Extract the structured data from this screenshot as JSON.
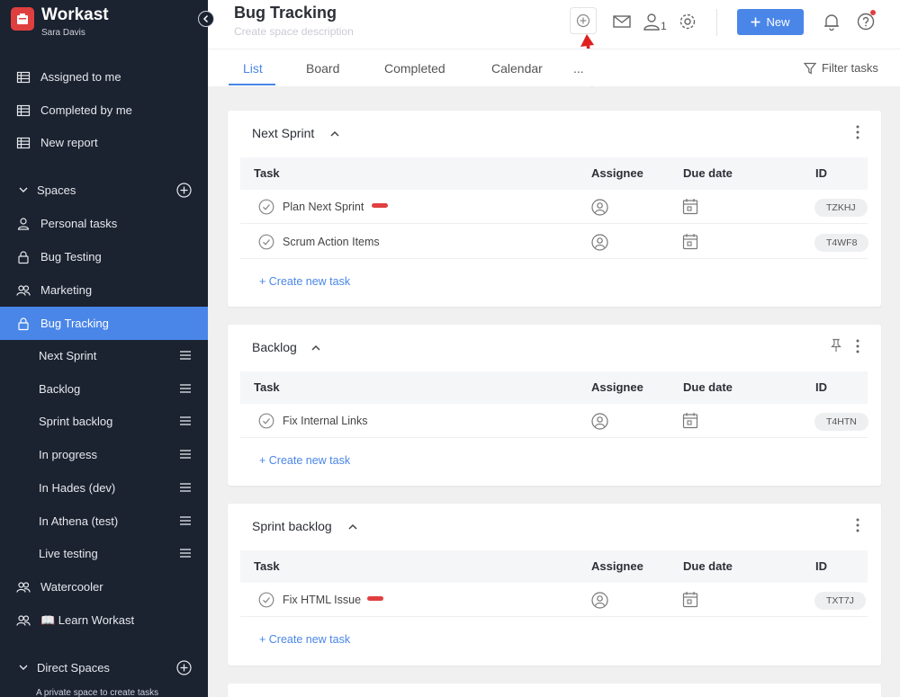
{
  "brand": {
    "name": "Workast",
    "user": "Sara Davis"
  },
  "sidebar": {
    "top_items": [
      {
        "label": "Assigned to me",
        "icon": "table-icon"
      },
      {
        "label": "Completed by me",
        "icon": "table-icon"
      },
      {
        "label": "New report",
        "icon": "table-icon"
      }
    ],
    "spaces_label": "Spaces",
    "spaces": [
      {
        "label": "Personal tasks",
        "icon": "person-icon"
      },
      {
        "label": "Bug Testing",
        "icon": "lock-icon"
      },
      {
        "label": "Marketing",
        "icon": "group-icon"
      },
      {
        "label": "Bug Tracking",
        "icon": "lock-icon",
        "active": true
      }
    ],
    "lists": [
      "Next Sprint",
      "Backlog",
      "Sprint backlog",
      "In progress",
      "In Hades (dev)",
      "In Athena (test)",
      "Live testing"
    ],
    "after_lists": [
      {
        "label": "Watercooler",
        "icon": "group-icon"
      },
      {
        "label": "📖 Learn Workast",
        "icon": "group-icon"
      }
    ],
    "direct_label": "Direct Spaces",
    "footer": "A private space to create tasks"
  },
  "header": {
    "title": "Bug Tracking",
    "description_placeholder": "Create space description",
    "member_count": "1",
    "new_label": "New"
  },
  "tabs": [
    "List",
    "Board",
    "Completed",
    "Calendar",
    "..."
  ],
  "filter_label": "Filter tasks",
  "columns": {
    "task": "Task",
    "assignee": "Assignee",
    "due": "Due date",
    "id": "ID"
  },
  "create_label": "+ Create new task",
  "sections": [
    {
      "title": "Next Sprint",
      "tasks": [
        {
          "name": "Plan Next Sprint",
          "id": "TZKHJ",
          "flag": true
        },
        {
          "name": "Scrum Action Items",
          "id": "T4WF8",
          "flag": false
        }
      ]
    },
    {
      "title": "Backlog",
      "tasks": [
        {
          "name": "Fix Internal Links",
          "id": "T4HTN",
          "flag": false
        }
      ]
    },
    {
      "title": "Sprint backlog",
      "tasks": [
        {
          "name": "Fix HTML Issue",
          "id": "TXT7J",
          "flag": true
        }
      ]
    }
  ],
  "colors": {
    "accent": "#4a86e8",
    "sidebar_bg": "#1b2230",
    "brand_red": "#e03f3f"
  }
}
